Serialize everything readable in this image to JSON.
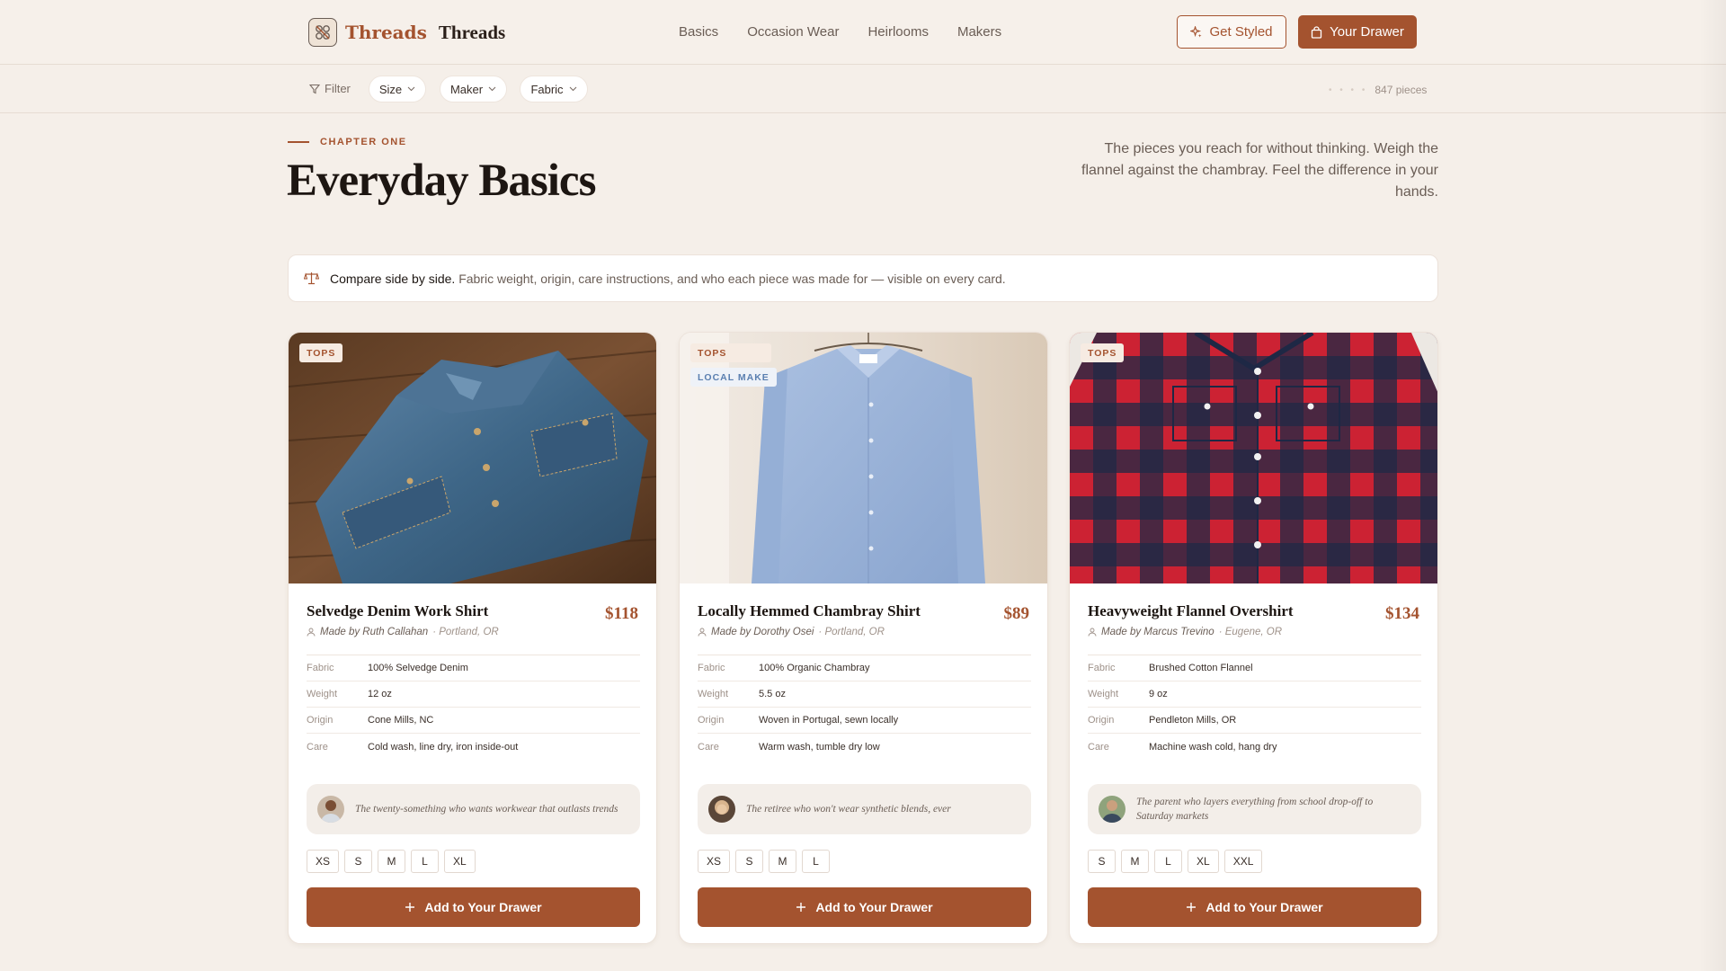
{
  "brand": {
    "name": "Threads",
    "name2": "Threads",
    "accent": "#a4532f"
  },
  "nav": {
    "items": [
      "Basics",
      "Occasion Wear",
      "Heirlooms",
      "Makers"
    ]
  },
  "header": {
    "styled_label": "Get Styled",
    "drawer_label": "Your Drawer"
  },
  "filters": {
    "filter_label": "Filter",
    "chips": [
      "Size",
      "Maker",
      "Fabric"
    ],
    "count": "847 pieces"
  },
  "section": {
    "eyebrow": "CHAPTER ONE",
    "title": "Everyday Basics",
    "intro": "The pieces you reach for without thinking. Weigh the flannel against the chambray. Feel the difference in your hands."
  },
  "compare": {
    "bold": "Compare side by side.",
    "text": "Fabric weight, origin, care instructions, and who each piece was made for — visible on every card."
  },
  "spec_labels": {
    "fabric": "Fabric",
    "weight": "Weight",
    "origin": "Origin",
    "care": "Care"
  },
  "add_label": "Add to Your Drawer",
  "products": [
    {
      "badges": [
        "TOPS"
      ],
      "title": "Selvedge Denim Work Shirt",
      "price": "$118",
      "maker": "Made by Ruth Callahan",
      "location": "Portland, OR",
      "fabric": "100% Selvedge Denim",
      "weight": "12 oz",
      "origin": "Cone Mills, NC",
      "care": "Cold wash, line dry, iron inside-out",
      "persona": "The twenty-something who wants workwear that outlasts trends",
      "sizes": [
        "XS",
        "S",
        "M",
        "L",
        "XL"
      ]
    },
    {
      "badges": [
        "TOPS",
        "LOCAL MAKE"
      ],
      "title": "Locally Hemmed Chambray Shirt",
      "price": "$89",
      "maker": "Made by Dorothy Osei",
      "location": "Portland, OR",
      "fabric": "100% Organic Chambray",
      "weight": "5.5 oz",
      "origin": "Woven in Portugal, sewn locally",
      "care": "Warm wash, tumble dry low",
      "persona": "The retiree who won't wear synthetic blends, ever",
      "sizes": [
        "XS",
        "S",
        "M",
        "L"
      ]
    },
    {
      "badges": [
        "TOPS"
      ],
      "title": "Heavyweight Flannel Overshirt",
      "price": "$134",
      "maker": "Made by Marcus Trevino",
      "location": "Eugene, OR",
      "fabric": "Brushed Cotton Flannel",
      "weight": "9 oz",
      "origin": "Pendleton Mills, OR",
      "care": "Machine wash cold, hang dry",
      "persona": "The parent who layers everything from school drop-off to Saturday markets",
      "sizes": [
        "S",
        "M",
        "L",
        "XL",
        "XXL"
      ]
    }
  ]
}
